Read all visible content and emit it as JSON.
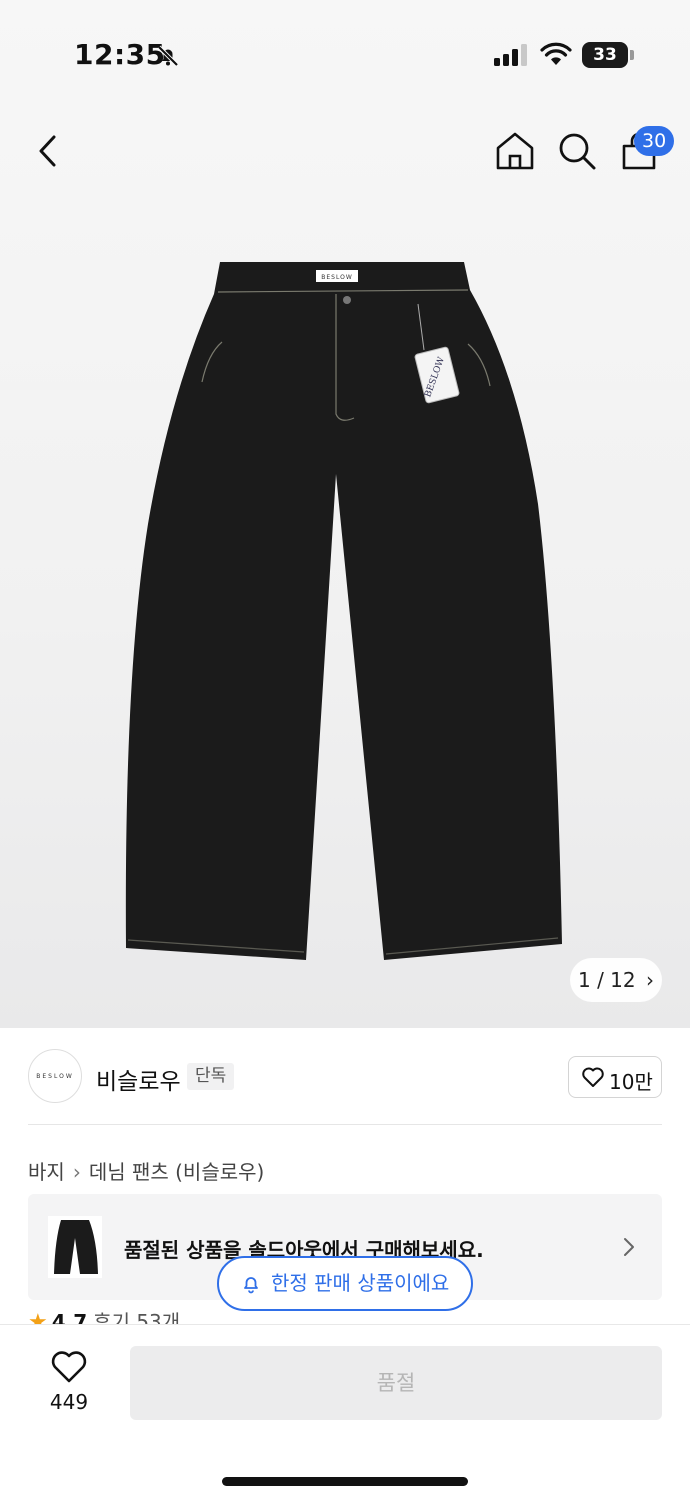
{
  "status_bar": {
    "time": "12:35",
    "battery": "33"
  },
  "header": {
    "cart_count": "30"
  },
  "gallery": {
    "page_indicator": "1 / 12"
  },
  "brand": {
    "logo_text": "BESLOW",
    "name": "비슬로우",
    "badge": "단독",
    "likes": "10만"
  },
  "breadcrumb": {
    "items": [
      "바지",
      "데님 팬츠 (비슬로우)"
    ]
  },
  "soldout_banner": {
    "text": "품절된 상품을 솔드아웃에서 구매해보세요."
  },
  "limited_notice": {
    "text": "한정 판매 상품이에요"
  },
  "rating": {
    "score": "4.7",
    "reviews": "후기 53개"
  },
  "bottom_bar": {
    "wish_count": "449",
    "buy_label": "품절"
  },
  "product": {
    "tag_text": "BESLOW"
  },
  "colors": {
    "accent": "#2f6fe8",
    "star": "#f3a117"
  }
}
